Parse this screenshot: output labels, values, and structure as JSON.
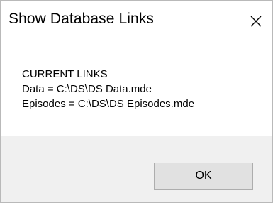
{
  "window": {
    "title": "Show Database Links"
  },
  "message": {
    "heading": "CURRENT LINKS",
    "lines": [
      "Data = C:\\DS\\DS Data.mde",
      "Episodes = C:\\DS\\DS Episodes.mde"
    ]
  },
  "buttons": {
    "ok_label": "OK"
  },
  "icons": {
    "close": "close-icon"
  },
  "colors": {
    "dialog_background": "#ffffff",
    "footer_background": "#f0f0f0",
    "button_background": "#e1e1e1",
    "button_border": "#adadad",
    "window_border": "#b9b9b9"
  }
}
